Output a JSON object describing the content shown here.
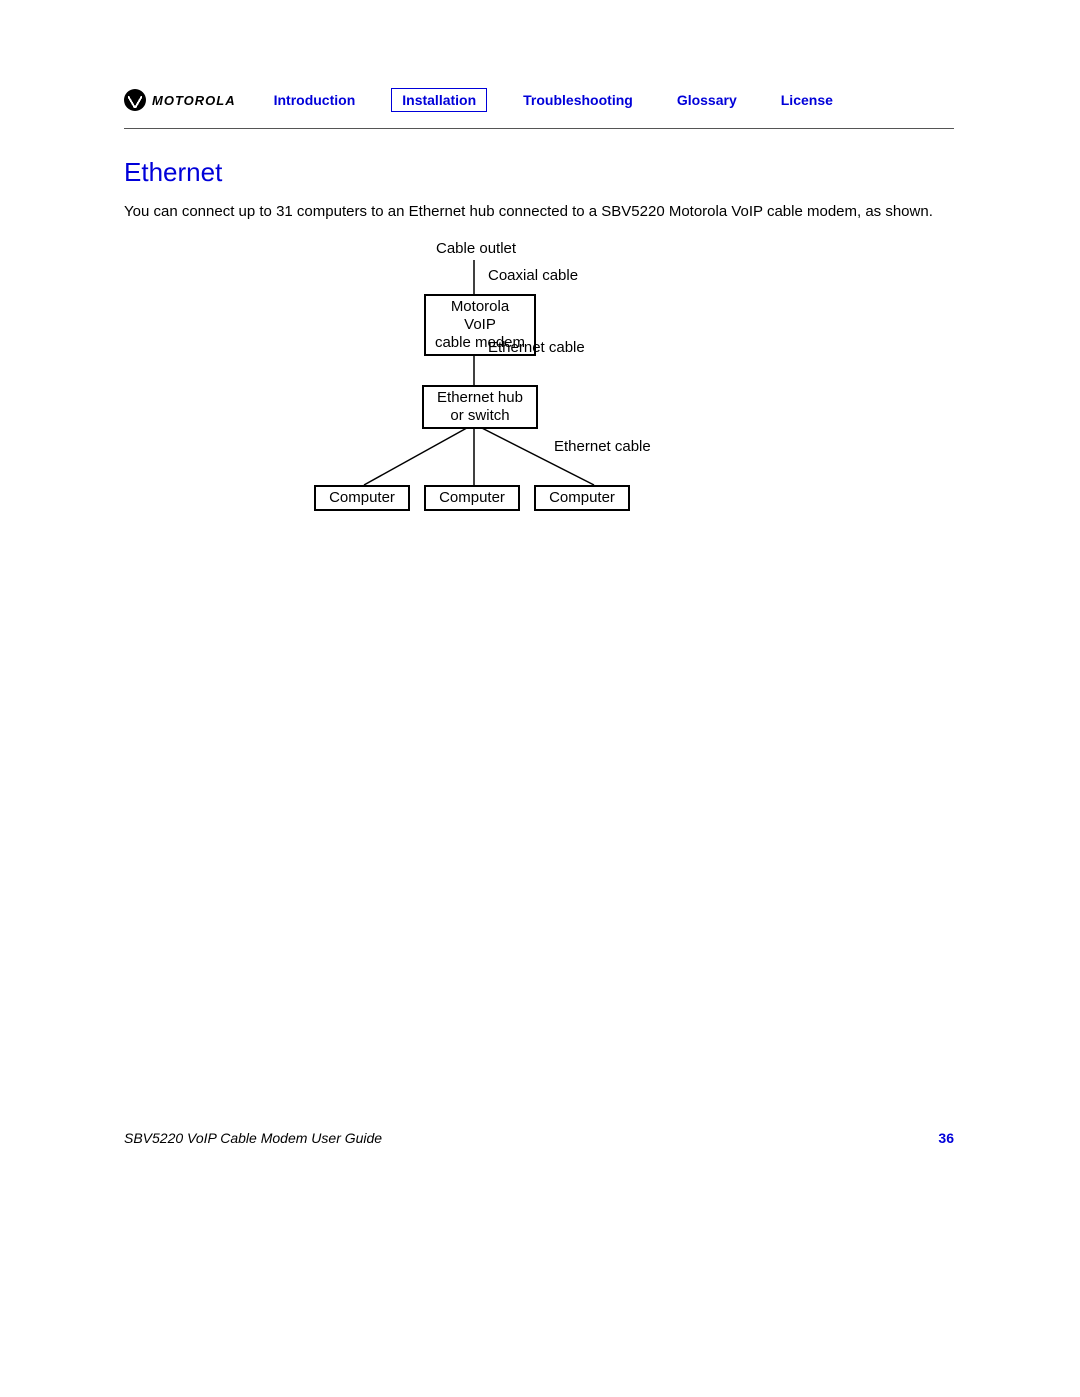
{
  "brand": "MOTOROLA",
  "nav": {
    "introduction": "Introduction",
    "installation": "Installation",
    "troubleshooting": "Troubleshooting",
    "glossary": "Glossary",
    "license": "License"
  },
  "section_title": "Ethernet",
  "body_text": "You can connect up to 31 computers to an Ethernet hub connected to a SBV5220 Motorola VoIP cable modem, as shown.",
  "diagram": {
    "cable_outlet": "Cable outlet",
    "coaxial_cable": "Coaxial cable",
    "modem_l1": "Motorola VoIP",
    "modem_l2": "cable modem",
    "ethernet_cable_top": "Ethernet cable",
    "hub_l1": "Ethernet hub",
    "hub_l2": "or switch",
    "ethernet_cable_mid": "Ethernet cable",
    "computer1": "Computer",
    "computer2": "Computer",
    "computer3": "Computer"
  },
  "footer": {
    "guide": "SBV5220 VoIP Cable Modem User Guide",
    "page": "36"
  }
}
